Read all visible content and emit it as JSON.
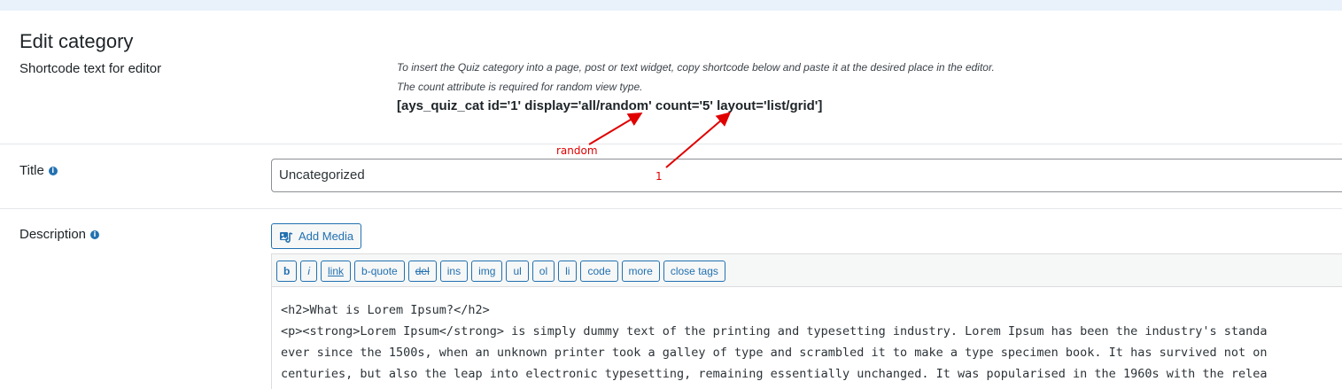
{
  "header": {
    "title": "Edit category"
  },
  "shortcode_section": {
    "label": "Shortcode text for editor",
    "hint_line_1": "To insert the Quiz category into a page, post or text widget, copy shortcode below and paste it at the desired place in the editor.",
    "hint_line_2": "The count attribute is required for random view type.",
    "shortcode": "[ays_quiz_cat id='1' display='all/random' count='5' layout='list/grid']"
  },
  "title_field": {
    "label": "Title",
    "value": "Uncategorized"
  },
  "description_field": {
    "label": "Description",
    "add_media_label": "Add Media",
    "toolbar": [
      {
        "label": "b",
        "style": "bold"
      },
      {
        "label": "i",
        "style": "italic"
      },
      {
        "label": "link",
        "style": "underline"
      },
      {
        "label": "b-quote",
        "style": "normal"
      },
      {
        "label": "del",
        "style": "strike"
      },
      {
        "label": "ins",
        "style": "normal"
      },
      {
        "label": "img",
        "style": "normal"
      },
      {
        "label": "ul",
        "style": "normal"
      },
      {
        "label": "ol",
        "style": "normal"
      },
      {
        "label": "li",
        "style": "normal"
      },
      {
        "label": "code",
        "style": "normal"
      },
      {
        "label": "more",
        "style": "normal"
      },
      {
        "label": "close tags",
        "style": "normal"
      }
    ],
    "content_lines": [
      "<h2>What is Lorem Ipsum?</h2>",
      "<p><strong>Lorem Ipsum</strong> is simply dummy text of the printing and typesetting industry. Lorem Ipsum has been the industry's standa",
      "ever since the 1500s, when an unknown printer took a galley of type and scrambled it to make a type specimen book. It has survived not on",
      "centuries, but also the leap into electronic typesetting, remaining essentially unchanged. It was popularised in the 1960s with the relea"
    ]
  },
  "annotations": {
    "random_label": "random",
    "count_label": "1",
    "color": "#e00000"
  },
  "colors": {
    "accent": "#2271b1",
    "top_band": "#e9f2fb"
  }
}
